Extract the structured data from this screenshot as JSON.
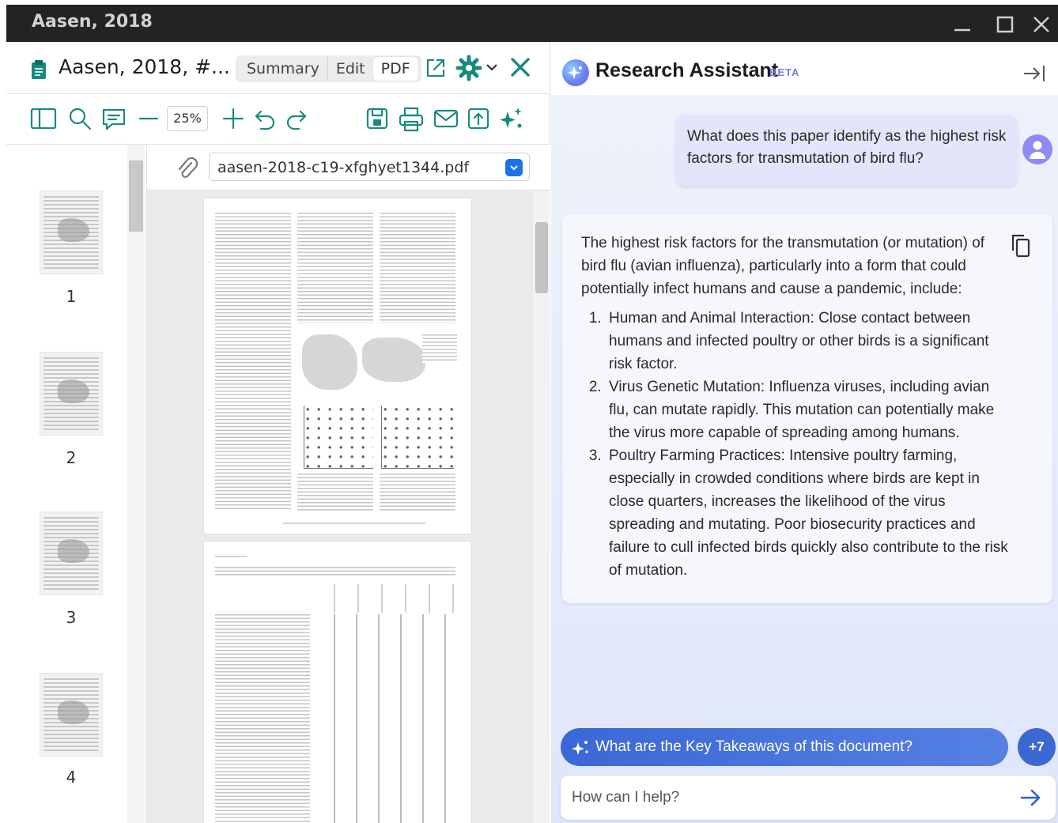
{
  "window": {
    "title": "Aasen, 2018"
  },
  "document": {
    "tab_title": "Aasen, 2018, #...",
    "views": [
      "Summary",
      "Edit",
      "PDF"
    ],
    "active_view": "PDF",
    "zoom": "25%",
    "filename": "aasen-2018-c19-xfghyet1344.pdf"
  },
  "thumbnails": [
    "1",
    "2",
    "3",
    "4"
  ],
  "assistant": {
    "title": "Research Assistant",
    "badge": "BETA",
    "user_question": "What does this paper identify as the highest risk factors for transmutation of bird flu?",
    "answer_intro": "The highest risk factors for the transmutation (or mutation) of bird flu (avian influenza), particularly into a form that could potentially infect humans and cause a pandemic, include:",
    "answer_items": [
      "Human and Animal Interaction: Close contact between humans and infected poultry or other birds is a significant risk factor.",
      "Virus Genetic Mutation: Influenza viruses, including avian flu, can mutate rapidly. This mutation can potentially make the virus more capable of spreading among humans.",
      "Poultry Farming Practices: Intensive poultry farming, especially in crowded conditions where birds are kept in close quarters, increases the likelihood of the virus spreading and mutating. Poor biosecurity practices and failure to cull infected birds quickly also contribute to the risk of mutation."
    ],
    "suggestion": "What are the Key Takeaways of this document?",
    "more_count": "+7",
    "input_placeholder": "How can I help?"
  },
  "colors": {
    "accent_teal": "#1a8a80",
    "assistant_blue": "#3a68d6",
    "avatar_purple": "#8f8bf3"
  },
  "icons": [
    "clipboard-icon",
    "external-link-icon",
    "gear-icon",
    "chevron-down-icon",
    "close-icon",
    "sidebar-toggle-icon",
    "search-icon",
    "comment-icon",
    "zoom-out-icon",
    "zoom-in-icon",
    "undo-icon",
    "redo-icon",
    "save-icon",
    "print-icon",
    "mail-icon",
    "export-icon",
    "sparkle-icon",
    "paperclip-icon",
    "copy-icon",
    "send-arrow-icon",
    "collapse-panel-icon",
    "user-icon"
  ]
}
